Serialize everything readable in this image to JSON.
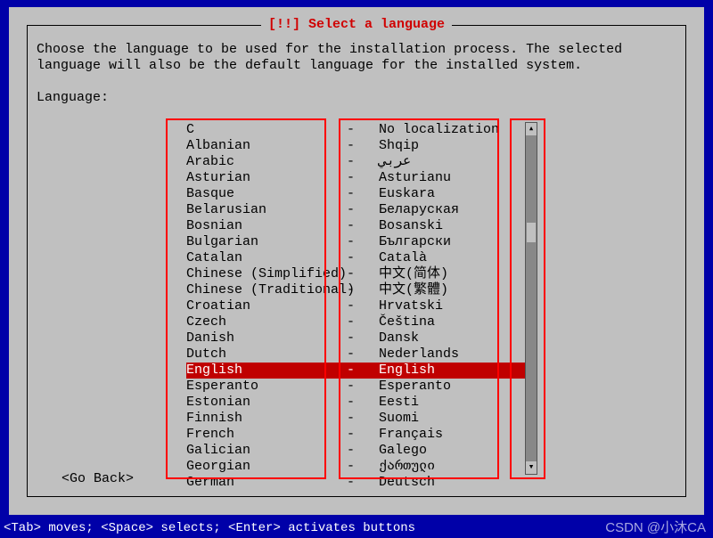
{
  "dialog": {
    "title": "[!!] Select a language",
    "instructions": "Choose the language to be used for the installation process. The selected language will also be the default language for the installed system.",
    "label": "Language:",
    "go_back": "<Go Back>"
  },
  "status_bar": "<Tab> moves; <Space> selects; <Enter> activates buttons",
  "watermark": "CSDN @小沐CA",
  "selected_index": 15,
  "languages": [
    {
      "en": "C",
      "native": "No localization"
    },
    {
      "en": "Albanian",
      "native": "Shqip"
    },
    {
      "en": "Arabic",
      "native": "عربي"
    },
    {
      "en": "Asturian",
      "native": "Asturianu"
    },
    {
      "en": "Basque",
      "native": "Euskara"
    },
    {
      "en": "Belarusian",
      "native": "Беларуская"
    },
    {
      "en": "Bosnian",
      "native": "Bosanski"
    },
    {
      "en": "Bulgarian",
      "native": "Български"
    },
    {
      "en": "Catalan",
      "native": "Català"
    },
    {
      "en": "Chinese (Simplified)",
      "native": "中文(简体)"
    },
    {
      "en": "Chinese (Traditional)",
      "native": "中文(繁體)"
    },
    {
      "en": "Croatian",
      "native": "Hrvatski"
    },
    {
      "en": "Czech",
      "native": "Čeština"
    },
    {
      "en": "Danish",
      "native": "Dansk"
    },
    {
      "en": "Dutch",
      "native": "Nederlands"
    },
    {
      "en": "English",
      "native": "English"
    },
    {
      "en": "Esperanto",
      "native": "Esperanto"
    },
    {
      "en": "Estonian",
      "native": "Eesti"
    },
    {
      "en": "Finnish",
      "native": "Suomi"
    },
    {
      "en": "French",
      "native": "Français"
    },
    {
      "en": "Galician",
      "native": "Galego"
    },
    {
      "en": "Georgian",
      "native": "ქართული"
    },
    {
      "en": "German",
      "native": "Deutsch"
    }
  ]
}
